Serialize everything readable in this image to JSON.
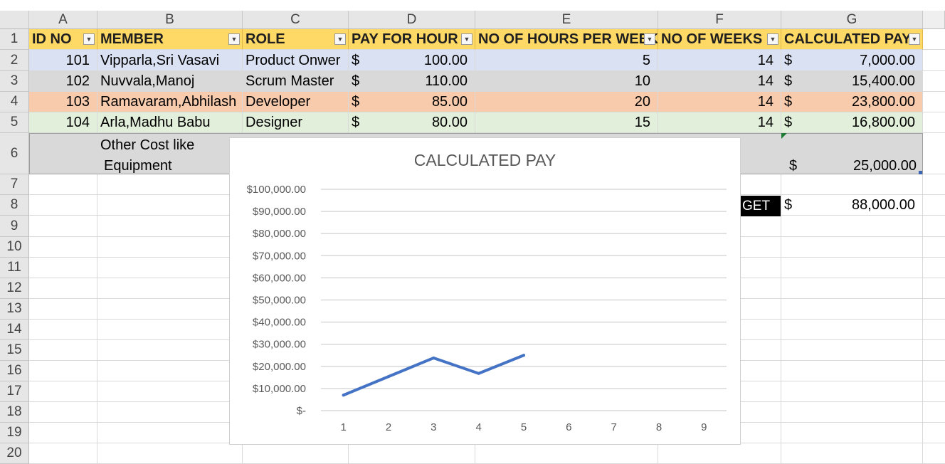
{
  "columns": [
    "A",
    "B",
    "C",
    "D",
    "E",
    "F",
    "G"
  ],
  "rows": [
    "1",
    "2",
    "3",
    "4",
    "5",
    "6",
    "7",
    "8",
    "9",
    "10",
    "11",
    "12",
    "13",
    "14",
    "15",
    "16",
    "17",
    "18",
    "19",
    "20"
  ],
  "headers": [
    "ID NO",
    "MEMBER",
    "ROLE",
    "PAY FOR HOUR",
    "NO OF HOURS PER WEEK",
    "NO OF WEEKS",
    "CALCULATED PAY"
  ],
  "table": [
    {
      "id": "101",
      "member": "Vipparla,Sri Vasavi",
      "role": "Product Onwer",
      "pay": "100.00",
      "hours": "5",
      "weeks": "14",
      "calc": "7,000.00"
    },
    {
      "id": "102",
      "member": "Nuvvala,Manoj",
      "role": "Scrum Master",
      "pay": "110.00",
      "hours": "10",
      "weeks": "14",
      "calc": "15,400.00"
    },
    {
      "id": "103",
      "member": "Ramavaram,Abhilash",
      "role": "Developer",
      "pay": "85.00",
      "hours": "20",
      "weeks": "14",
      "calc": "23,800.00"
    },
    {
      "id": "104",
      "member": "Arla,Madhu Babu",
      "role": "Designer",
      "pay": "80.00",
      "hours": "15",
      "weeks": "14",
      "calc": "16,800.00"
    }
  ],
  "other_cost": {
    "line1": "Other Cost like",
    "line2": "Equipment",
    "value": "25,000.00"
  },
  "budget": {
    "label_visible": "GET",
    "value": "88,000.00"
  },
  "currency": "$",
  "row_colors": [
    "#d9e1f2",
    "#d9d9d9",
    "#f8cbad",
    "#e2efda"
  ],
  "header_color": "#ffd966",
  "chart_data": {
    "type": "line",
    "title": "CALCULATED PAY",
    "x": [
      1,
      2,
      3,
      4,
      5,
      6,
      7,
      8,
      9
    ],
    "series": [
      {
        "values": [
          7000,
          15400,
          23800,
          16800,
          25000
        ]
      }
    ],
    "ylim": [
      0,
      100000
    ],
    "yticks": [
      "$-",
      "$10,000.00",
      "$20,000.00",
      "$30,000.00",
      "$40,000.00",
      "$50,000.00",
      "$60,000.00",
      "$70,000.00",
      "$80,000.00",
      "$90,000.00",
      "$100,000.00"
    ],
    "grid": true,
    "line_color": "#4472c4"
  }
}
